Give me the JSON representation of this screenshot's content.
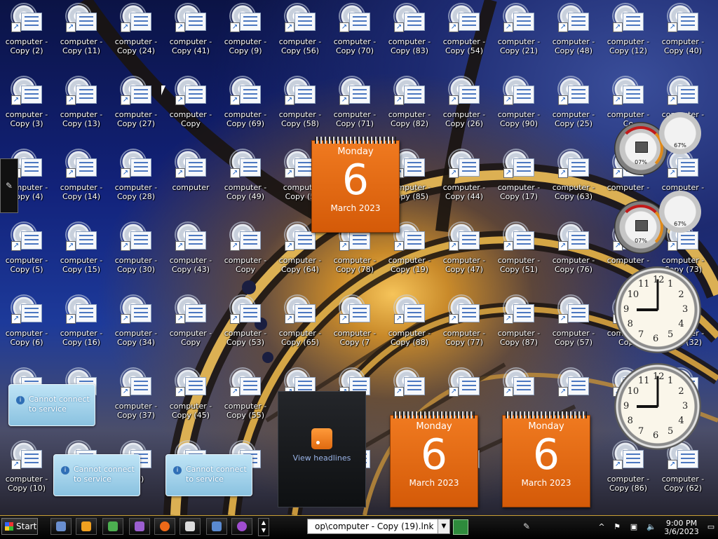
{
  "desktop": {
    "icon_rows": [
      [
        {
          "l1": "computer -",
          "l2": "Copy (2)"
        },
        {
          "l1": "computer -",
          "l2": "Copy (11)"
        },
        {
          "l1": "computer -",
          "l2": "Copy (24)"
        },
        {
          "l1": "computer -",
          "l2": "Copy (41)"
        },
        {
          "l1": "computer -",
          "l2": "Copy (9)"
        },
        {
          "l1": "computer -",
          "l2": "Copy (56)"
        },
        {
          "l1": "computer -",
          "l2": "Copy (70)"
        },
        {
          "l1": "computer -",
          "l2": "Copy (83)"
        },
        {
          "l1": "computer -",
          "l2": "Copy (54)"
        },
        {
          "l1": "computer -",
          "l2": "Copy (21)"
        },
        {
          "l1": "computer -",
          "l2": "Copy (48)"
        },
        {
          "l1": "computer -",
          "l2": "Copy (12)"
        },
        {
          "l1": "computer -",
          "l2": "Copy (40)"
        }
      ],
      [
        {
          "l1": "computer -",
          "l2": "Copy (3)"
        },
        {
          "l1": "computer -",
          "l2": "Copy (13)"
        },
        {
          "l1": "computer -",
          "l2": "Copy (27)"
        },
        {
          "l1": "computer -",
          "l2": "Copy"
        },
        {
          "l1": "computer -",
          "l2": "Copy (69)"
        },
        {
          "l1": "computer -",
          "l2": "Copy (58)"
        },
        {
          "l1": "computer -",
          "l2": "Copy (71)"
        },
        {
          "l1": "computer -",
          "l2": "Copy (82)"
        },
        {
          "l1": "computer -",
          "l2": "Copy (26)"
        },
        {
          "l1": "computer -",
          "l2": "Copy (90)"
        },
        {
          "l1": "computer -",
          "l2": "Copy (25)"
        },
        {
          "l1": "computer -",
          "l2": "Co"
        },
        {
          "l1": "computer -",
          "l2": ""
        }
      ],
      [
        {
          "l1": "computer -",
          "l2": "Copy (4)"
        },
        {
          "l1": "computer -",
          "l2": "Copy (14)"
        },
        {
          "l1": "computer -",
          "l2": "Copy (28)"
        },
        {
          "l1": "computer",
          "l2": ""
        },
        {
          "l1": "computer -",
          "l2": "Copy (49)"
        },
        {
          "l1": "compute",
          "l2": "Copy (5"
        },
        {
          "l1": "",
          "l2": ""
        },
        {
          "l1": "computer -",
          "l2": "Copy (85)"
        },
        {
          "l1": "computer -",
          "l2": "Copy (44)"
        },
        {
          "l1": "computer -",
          "l2": "Copy (17)"
        },
        {
          "l1": "computer -",
          "l2": "Copy (63)"
        },
        {
          "l1": "computer -",
          "l2": ""
        },
        {
          "l1": "computer -",
          "l2": ""
        }
      ],
      [
        {
          "l1": "computer -",
          "l2": "Copy (5)"
        },
        {
          "l1": "computer -",
          "l2": "Copy (15)"
        },
        {
          "l1": "computer -",
          "l2": "Copy (30)"
        },
        {
          "l1": "computer -",
          "l2": "Copy (43)"
        },
        {
          "l1": "computer -",
          "l2": "Copy"
        },
        {
          "l1": "computer -",
          "l2": "Copy (64)"
        },
        {
          "l1": "computer -",
          "l2": "Copy (78)"
        },
        {
          "l1": "computer -",
          "l2": "Copy (19)"
        },
        {
          "l1": "computer -",
          "l2": "Copy (47)"
        },
        {
          "l1": "computer -",
          "l2": "Copy (51)"
        },
        {
          "l1": "computer -",
          "l2": "Copy (76)"
        },
        {
          "l1": "computer -",
          "l2": ""
        },
        {
          "l1": "computer -",
          "l2": "Copy (73)"
        }
      ],
      [
        {
          "l1": "computer -",
          "l2": "Copy (6)"
        },
        {
          "l1": "computer -",
          "l2": "Copy (16)"
        },
        {
          "l1": "computer -",
          "l2": "Copy (34)"
        },
        {
          "l1": "computer -",
          "l2": "Copy"
        },
        {
          "l1": "computer -",
          "l2": "Copy (53)"
        },
        {
          "l1": "computer -",
          "l2": "Copy (65)"
        },
        {
          "l1": "computer -",
          "l2": "Copy (7"
        },
        {
          "l1": "computer -",
          "l2": "Copy (88)"
        },
        {
          "l1": "computer -",
          "l2": "Copy (77)"
        },
        {
          "l1": "computer -",
          "l2": "Copy (87)"
        },
        {
          "l1": "computer -",
          "l2": "Copy (57)"
        },
        {
          "l1": "computer -",
          "l2": "Copy"
        },
        {
          "l1": "computer -",
          "l2": "Copy (32)"
        }
      ],
      [
        {
          "l1": "",
          "l2": ""
        },
        {
          "l1": "",
          "l2": ""
        },
        {
          "l1": "computer -",
          "l2": "Copy (37)"
        },
        {
          "l1": "computer -",
          "l2": "Copy (45)"
        },
        {
          "l1": "computer -",
          "l2": "Copy (55)"
        },
        {
          "l1": "",
          "l2": ""
        },
        {
          "l1": "",
          "l2": ""
        },
        {
          "l1": "",
          "l2": ""
        },
        {
          "l1": "",
          "l2": ""
        },
        {
          "l1": "",
          "l2": ""
        },
        {
          "l1": "",
          "l2": ""
        },
        {
          "l1": "",
          "l2": ""
        },
        {
          "l1": "",
          "l2": ""
        }
      ],
      [
        {
          "l1": "computer -",
          "l2": "Copy (10)"
        },
        {
          "l1": "",
          "l2": ""
        },
        {
          "l1": "",
          "l2": "(39)"
        },
        {
          "l1": "",
          "l2": "(42)"
        },
        {
          "l1": "",
          "l2": ""
        },
        {
          "l1": "",
          "l2": ""
        },
        {
          "l1": "",
          "l2": "31)"
        },
        {
          "l1": "",
          "l2": ""
        },
        {
          "l1": "",
          "l2": "2)"
        },
        {
          "l1": "",
          "l2": ""
        },
        {
          "l1": "",
          "l2": ""
        },
        {
          "l1": "computer -",
          "l2": "Copy (86)"
        },
        {
          "l1": "computer -",
          "l2": "Copy (62)"
        }
      ]
    ]
  },
  "calendars": [
    {
      "weekday": "Monday",
      "day": "6",
      "month": "March 2023"
    },
    {
      "weekday": "Monday",
      "day": "6",
      "month": "March 2023"
    },
    {
      "weekday": "Monday",
      "day": "6",
      "month": "March 2023"
    }
  ],
  "gauges": [
    {
      "percent": "07%"
    },
    {
      "percent": "67%"
    },
    {
      "percent": "07%"
    },
    {
      "percent": "67%"
    }
  ],
  "clocks": {
    "numerals": [
      "12",
      "1",
      "2",
      "3",
      "4",
      "5",
      "6",
      "7",
      "8",
      "9",
      "10",
      "11"
    ]
  },
  "notices": [
    {
      "text": "Cannot connect to service"
    },
    {
      "text": "Cannot connect to service"
    },
    {
      "text": "Cannot connect to service"
    }
  ],
  "feed": {
    "label": "View headlines"
  },
  "taskbar": {
    "start_label": "Start",
    "task_entry": "op\\computer - Copy (19).lnk",
    "time": "9:00 PM",
    "date": "3/6/2023"
  },
  "icons": {
    "quick_launch": [
      "computer-icon",
      "media-player-icon",
      "screen-icon",
      "messenger-icon",
      "firefox-icon",
      "calculator-icon",
      "window-icon",
      "browser-icon"
    ],
    "tray": [
      "chevron-up-icon",
      "flag-icon",
      "network-icon",
      "volume-icon",
      "monitor-icon"
    ]
  }
}
